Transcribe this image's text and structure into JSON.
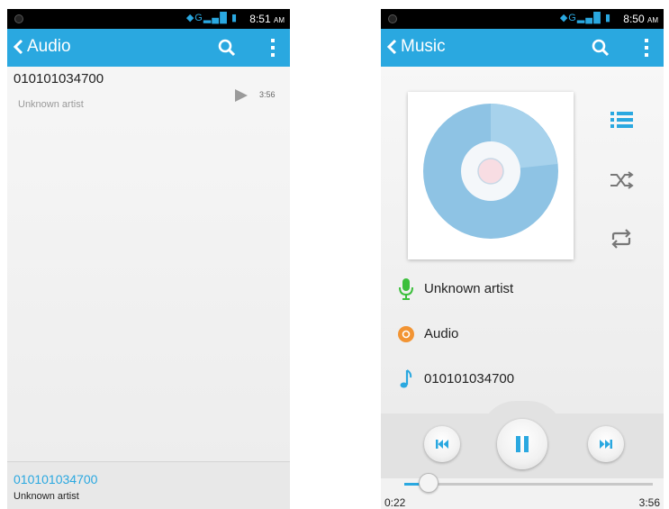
{
  "left_screen": {
    "status": {
      "time": "8:51",
      "ampm": "AM"
    },
    "appbar": {
      "title": "Audio"
    },
    "list": [
      {
        "title": "010101034700",
        "artist": "Unknown artist",
        "duration": "3:56"
      }
    ],
    "now_playing": {
      "title": "010101034700",
      "artist": "Unknown artist"
    }
  },
  "right_screen": {
    "status": {
      "time": "8:50",
      "ampm": "AM"
    },
    "appbar": {
      "title": "Music"
    },
    "info": {
      "artist": "Unknown artist",
      "album": "Audio",
      "track": "010101034700"
    },
    "playback": {
      "position": "0:22",
      "duration": "3:56",
      "progress_fraction": 0.093
    }
  },
  "colors": {
    "accent": "#2aa8e0",
    "mic": "#3cbf3c",
    "album": "#f29433"
  },
  "icons": [
    "back-chevron-icon",
    "search-icon",
    "overflow-menu-icon",
    "play-icon",
    "playlist-icon",
    "shuffle-icon",
    "repeat-icon",
    "microphone-icon",
    "album-disc-icon",
    "music-note-icon",
    "previous-icon",
    "pause-icon",
    "next-icon"
  ]
}
